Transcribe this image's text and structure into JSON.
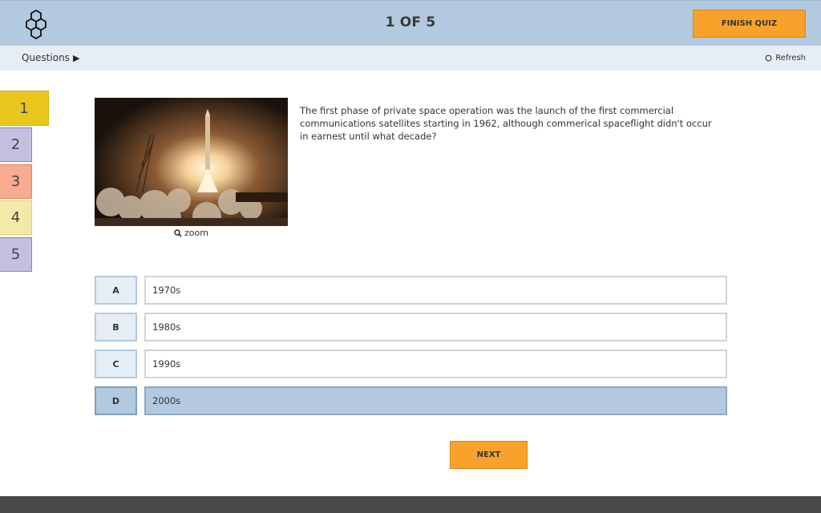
{
  "header": {
    "counter": "1 OF 5",
    "finish_label": "FINISH QUIZ",
    "logo_icon": "hexagon-cluster-icon"
  },
  "subbar": {
    "questions_label": "Questions",
    "questions_icon": "play-triangle-icon",
    "refresh_label": "Refresh",
    "refresh_icon": "refresh-circle-icon"
  },
  "question_nav": [
    {
      "label": "1",
      "color": "#e8c61c",
      "border": "#d4b30f",
      "active": true
    },
    {
      "label": "2",
      "color": "#c6bedf",
      "border": "#8f7fbf",
      "active": false
    },
    {
      "label": "3",
      "color": "#f8ab8e",
      "border": "#e57f59",
      "active": false
    },
    {
      "label": "4",
      "color": "#f3e9a8",
      "border": "#e0cf60",
      "active": false
    },
    {
      "label": "5",
      "color": "#c6bedf",
      "border": "#8f7fbf",
      "active": false
    }
  ],
  "question": {
    "text": "The first phase of private space operation was the launch of the first commercial communications satellites starting in 1962, although commerical spaceflight didn't occur in earnest until what decade?",
    "zoom_label": "zoom",
    "zoom_icon": "magnifier-icon"
  },
  "answers": [
    {
      "letter": "A",
      "text": "1970s",
      "selected": false
    },
    {
      "letter": "B",
      "text": "1980s",
      "selected": false
    },
    {
      "letter": "C",
      "text": "1990s",
      "selected": false
    },
    {
      "letter": "D",
      "text": "2000s",
      "selected": true
    }
  ],
  "next_label": "NEXT",
  "colors": {
    "header_bg": "#b2c9df",
    "accent_orange": "#f8a22b",
    "selected_answer": "#b2c9df"
  }
}
